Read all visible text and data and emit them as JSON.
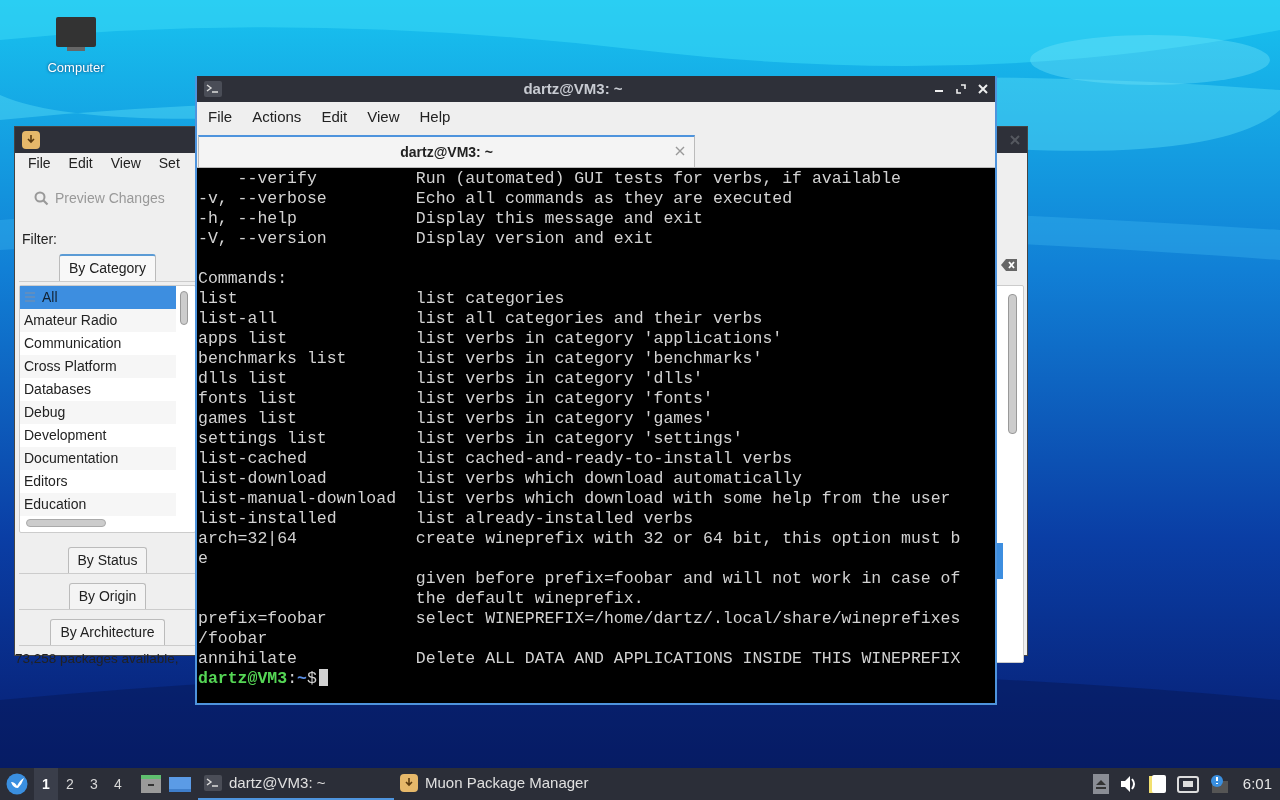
{
  "desktop": {
    "icons": [
      {
        "label": "Computer"
      }
    ]
  },
  "muon_window": {
    "menu": [
      "File",
      "Edit",
      "View",
      "Set"
    ],
    "preview_button": {
      "label": "Preview Changes",
      "disabled": true
    },
    "filter_label": "Filter:",
    "filter_sections": [
      {
        "label": "By Category",
        "selected": true,
        "categories": [
          {
            "label": "All",
            "selected": true
          },
          {
            "label": "Amateur Radio",
            "selected": false
          },
          {
            "label": "Communication",
            "selected": false
          },
          {
            "label": "Cross Platform",
            "selected": false
          },
          {
            "label": "Databases",
            "selected": false
          },
          {
            "label": "Debug",
            "selected": false
          },
          {
            "label": "Development",
            "selected": false
          },
          {
            "label": "Documentation",
            "selected": false
          },
          {
            "label": "Editors",
            "selected": false
          },
          {
            "label": "Education",
            "selected": false
          }
        ]
      },
      {
        "label": "By Status",
        "selected": false
      },
      {
        "label": "By Origin",
        "selected": false
      },
      {
        "label": "By Architecture",
        "selected": false
      }
    ],
    "status": "73,258 packages available,"
  },
  "terminal": {
    "title": "dartz@VM3: ~",
    "menu": [
      "File",
      "Actions",
      "Edit",
      "View",
      "Help"
    ],
    "tabs": [
      {
        "label": "dartz@VM3: ~",
        "selected": true
      }
    ],
    "sections": [
      {
        "lines": [
          "    --verify          Run (automated) GUI tests for verbs, if available",
          "-v, --verbose         Echo all commands as they are executed",
          "-h, --help            Display this message and exit",
          "-V, --version         Display version and exit"
        ]
      },
      {
        "lines": [
          "Commands:",
          "list                  list categories",
          "list-all              list all categories and their verbs",
          "apps list             list verbs in category 'applications'",
          "benchmarks list       list verbs in category 'benchmarks'",
          "dlls list             list verbs in category 'dlls'",
          "fonts list            list verbs in category 'fonts'",
          "games list            list verbs in category 'games'",
          "settings list         list verbs in category 'settings'",
          "list-cached           list cached-and-ready-to-install verbs",
          "list-download         list verbs which download automatically",
          "list-manual-download  list verbs which download with some help from the user",
          "list-installed        list already-installed verbs",
          "arch=32|64            create wineprefix with 32 or 64 bit, this option must b",
          "e",
          "                      given before prefix=foobar and will not work in case of",
          "                      the default wineprefix.",
          "prefix=foobar         select WINEPREFIX=/home/dartz/.local/share/wineprefixes",
          "/foobar",
          "annihilate            Delete ALL DATA AND APPLICATIONS INSIDE THIS WINEPREFIX"
        ]
      }
    ],
    "prompt": {
      "user_host": "dartz@VM3",
      "separator": ":",
      "path": "~",
      "symbol": "$"
    }
  },
  "taskbar": {
    "workspaces": [
      {
        "label": "1",
        "selected": true
      },
      {
        "label": "2",
        "selected": false
      },
      {
        "label": "3",
        "selected": false
      },
      {
        "label": "4",
        "selected": false
      }
    ],
    "tasks": [
      {
        "kind": "terminal",
        "label": "dartz@VM3: ~",
        "selected": true
      },
      {
        "kind": "package-manager",
        "label": "Muon Package Manager",
        "selected": false
      }
    ],
    "clock": "6:01"
  }
}
